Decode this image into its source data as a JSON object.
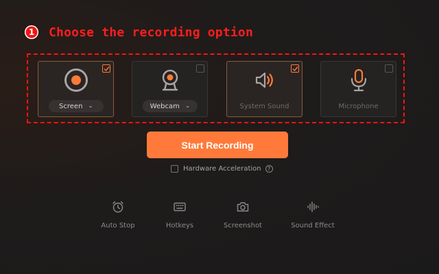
{
  "step": {
    "number": "1",
    "title": "Choose the recording option"
  },
  "options": [
    {
      "key": "screen",
      "label": "Screen",
      "has_dropdown": true,
      "checked": true,
      "icon": "record-icon"
    },
    {
      "key": "webcam",
      "label": "Webcam",
      "has_dropdown": true,
      "checked": false,
      "icon": "webcam-icon"
    },
    {
      "key": "system_sound",
      "label": "System Sound",
      "has_dropdown": false,
      "checked": true,
      "icon": "speaker-icon"
    },
    {
      "key": "microphone",
      "label": "Microphone",
      "has_dropdown": false,
      "checked": false,
      "icon": "microphone-icon"
    }
  ],
  "start_button": {
    "label": "Start Recording"
  },
  "hardware_acceleration": {
    "label": "Hardware Acceleration",
    "checked": false,
    "help": "?"
  },
  "tools": [
    {
      "label": "Auto Stop",
      "icon": "alarm-clock-icon"
    },
    {
      "label": "Hotkeys",
      "icon": "keyboard-icon"
    },
    {
      "label": "Screenshot",
      "icon": "camera-icon"
    },
    {
      "label": "Sound Effect",
      "icon": "sound-wave-icon"
    }
  ],
  "colors": {
    "accent": "#ff7a3a",
    "highlight_red": "#ff1e1e",
    "background": "#1c1b1b"
  }
}
